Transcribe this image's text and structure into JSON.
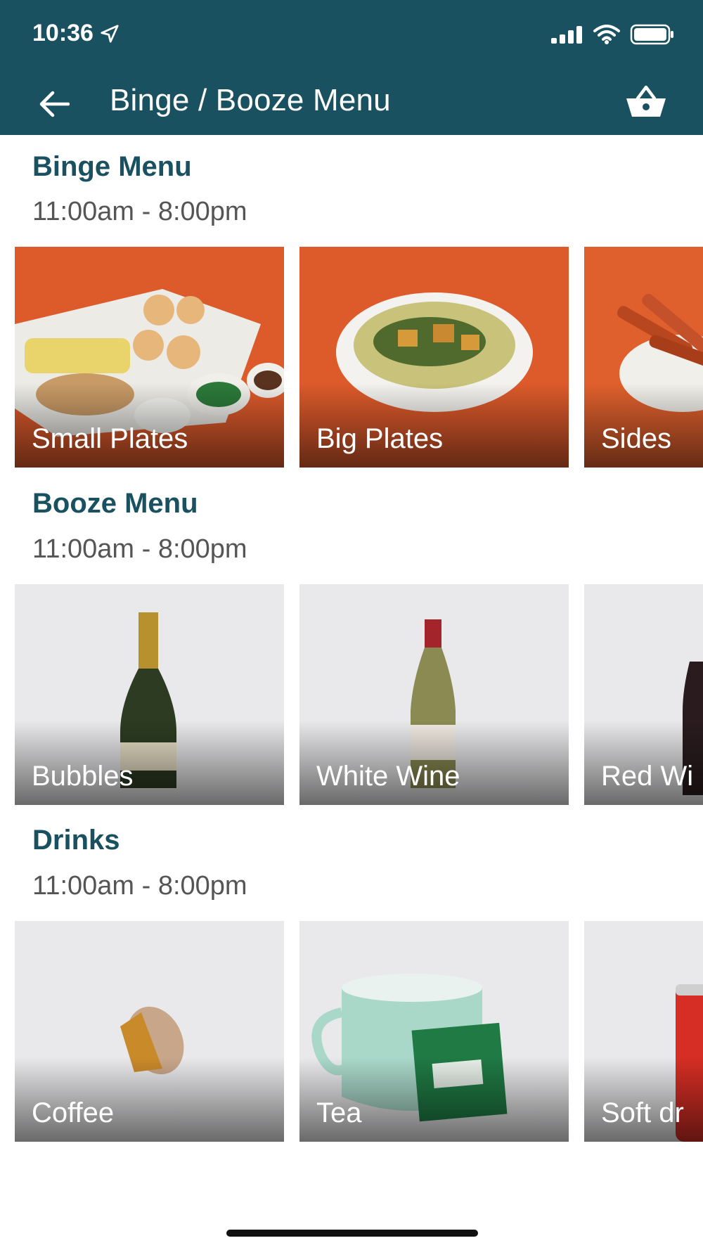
{
  "status_bar": {
    "time": "10:36",
    "icons": [
      "location-arrow-icon",
      "cellular-signal-icon",
      "wifi-icon",
      "battery-icon"
    ]
  },
  "header": {
    "title": "Binge / Booze Menu",
    "back_icon": "back-arrow-icon",
    "basket_icon": "basket-icon",
    "color": "#1a5160"
  },
  "sections": [
    {
      "title": "Binge Menu",
      "hours": "11:00am - 8:00pm",
      "tiles": [
        {
          "label": "Small Plates",
          "bg": "#e05a2a",
          "image": "tray of pani puri and chaat"
        },
        {
          "label": "Big Plates",
          "bg": "#e05a2a",
          "image": "bowl of curry with paneer"
        },
        {
          "label": "Sides",
          "bg": "#e05a2a",
          "image": "sweet potato fries"
        }
      ]
    },
    {
      "title": "Booze Menu",
      "hours": "11:00am - 8:00pm",
      "tiles": [
        {
          "label": "Bubbles",
          "bg": "#e8e8ea",
          "image": "champagne bottle"
        },
        {
          "label": "White Wine",
          "bg": "#e8e8ea",
          "image": "white wine bottle"
        },
        {
          "label": "Red Wi",
          "bg": "#e8e8ea",
          "image": "red wine bottle"
        }
      ]
    },
    {
      "title": "Drinks",
      "hours": "11:00am - 8:00pm",
      "tiles": [
        {
          "label": "Coffee",
          "bg": "#e8e8ea",
          "image": "coffee capsule"
        },
        {
          "label": "Tea",
          "bg": "#e8e8ea",
          "image": "mug with tea bag"
        },
        {
          "label": "Soft dr",
          "bg": "#e8e8ea",
          "image": "soda can"
        }
      ]
    }
  ]
}
